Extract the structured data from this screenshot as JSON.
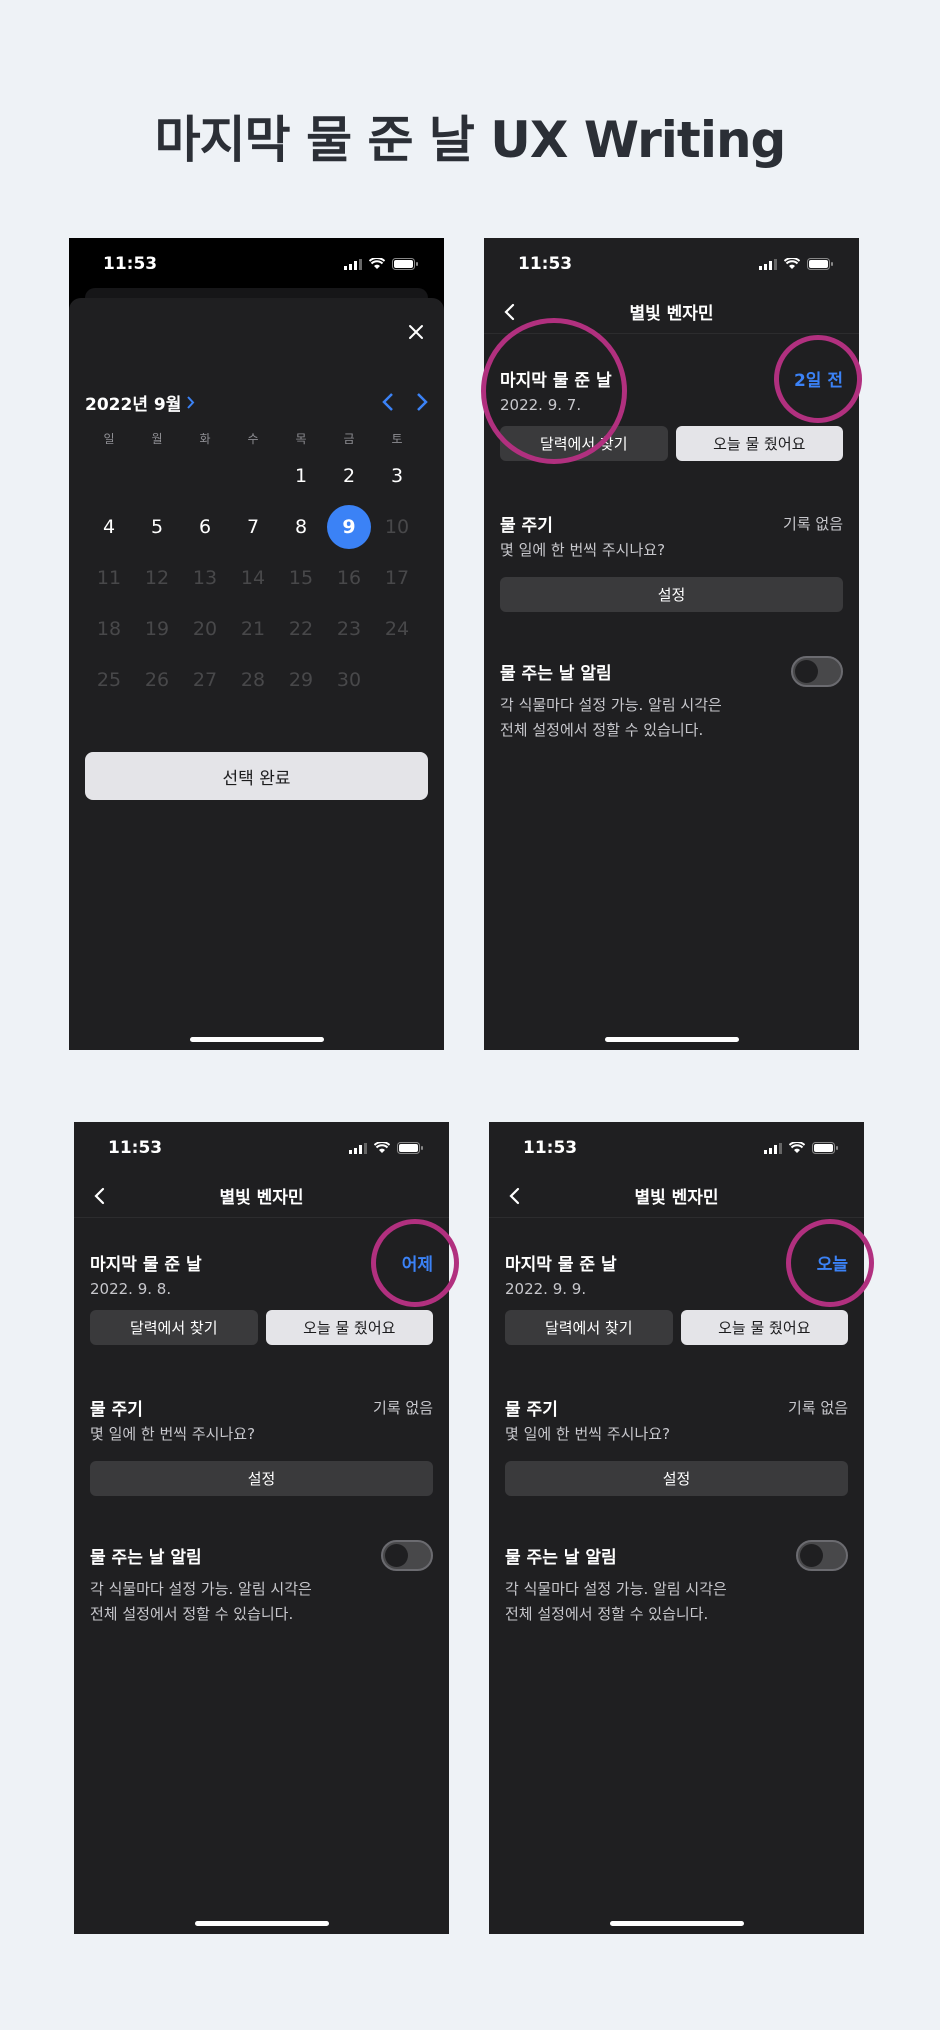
{
  "page": {
    "title": "마지막 물 준 날 UX Writing"
  },
  "status": {
    "time": "11:53"
  },
  "calendar": {
    "month_label": "2022년 9월",
    "weekdays": [
      "일",
      "월",
      "화",
      "수",
      "목",
      "금",
      "토"
    ],
    "days": [
      "",
      "",
      "",
      "",
      "1",
      "2",
      "3",
      "4",
      "5",
      "6",
      "7",
      "8",
      "9",
      "10",
      "11",
      "12",
      "13",
      "14",
      "15",
      "16",
      "17",
      "18",
      "19",
      "20",
      "21",
      "22",
      "23",
      "24",
      "25",
      "26",
      "27",
      "28",
      "29",
      "30",
      ""
    ],
    "selected_day": "9",
    "last_enabled_day": 9,
    "confirm_label": "선택 완료"
  },
  "detail": {
    "plant_name": "별빛 벤자민",
    "last_watered_label": "마지막 물 준 날",
    "find_in_calendar_label": "달력에서 찾기",
    "watered_today_label": "오늘 물 줬어요",
    "watering_cycle_label": "물 주기",
    "no_record_label": "기록 없음",
    "cycle_question": "몇 일에 한 번씩 주시나요?",
    "set_label": "설정",
    "alarm_label": "물 주는 날 알림",
    "alarm_desc_1": "각 식물마다 설정 가능. 알림 시각은",
    "alarm_desc_2": "전체 설정에서 정할 수 있습니다.",
    "screens": [
      {
        "date": "2022. 9. 7.",
        "relative": "2일 전"
      },
      {
        "date": "2022. 9. 8.",
        "relative": "어제"
      },
      {
        "date": "2022. 9. 9.",
        "relative": "오늘"
      }
    ]
  },
  "colors": {
    "accent": "#3b82f6",
    "highlight_ring": "#b1307f"
  }
}
